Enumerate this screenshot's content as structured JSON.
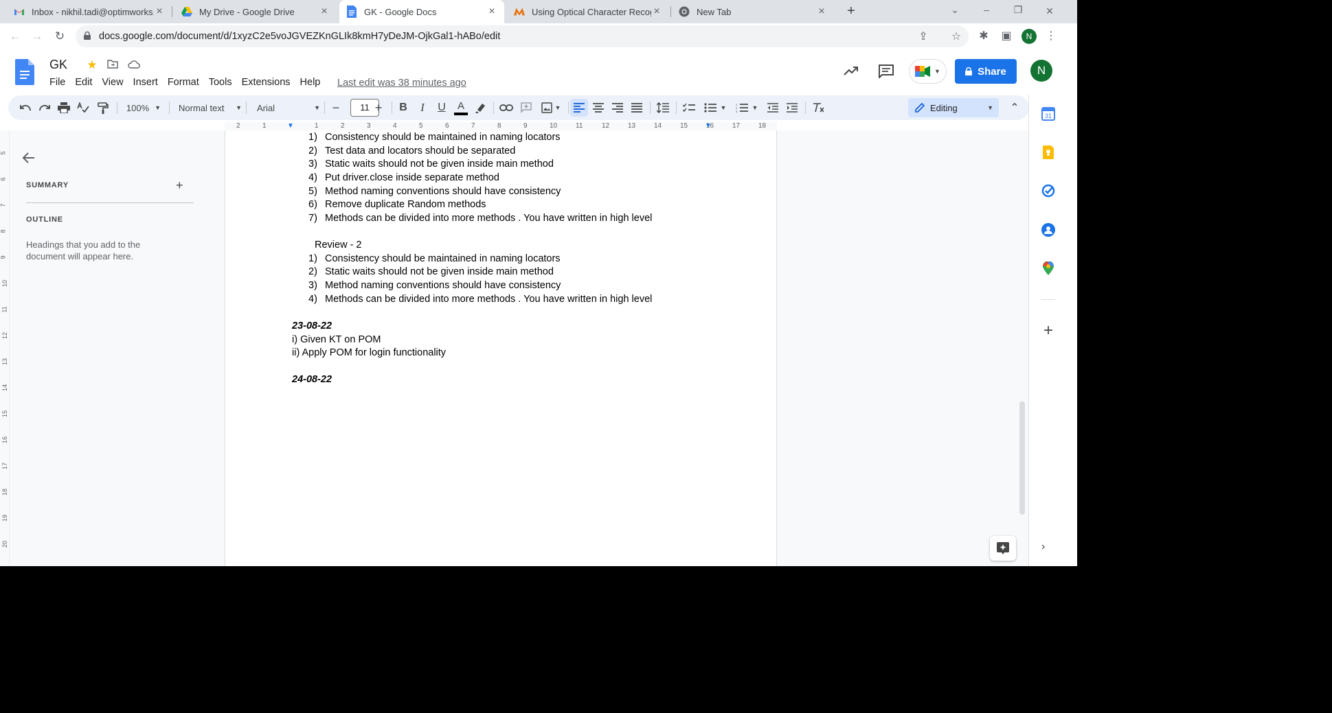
{
  "browser": {
    "tabs": [
      {
        "title": "Inbox - nikhil.tadi@optimworks.c",
        "icon": "gmail-icon"
      },
      {
        "title": "My Drive - Google Drive",
        "icon": "drive-icon"
      },
      {
        "title": "GK - Google Docs",
        "icon": "docs-icon",
        "active": true
      },
      {
        "title": "Using Optical Character Recognit",
        "icon": "ocr-site-icon"
      },
      {
        "title": "New Tab",
        "icon": "chrome-icon"
      }
    ],
    "url": "docs.google.com/document/d/1xyzC2e5voJGVEZKnGLIk8kmH7yDeJM-OjkGal1-hABo/edit",
    "profile_initial": "N"
  },
  "docs": {
    "title": "GK",
    "menu": [
      "File",
      "Edit",
      "View",
      "Insert",
      "Format",
      "Tools",
      "Extensions",
      "Help"
    ],
    "last_edit": "Last edit was 38 minutes ago",
    "share_label": "Share",
    "account_initial": "N"
  },
  "toolbar": {
    "zoom": "100%",
    "style": "Normal text",
    "font": "Arial",
    "font_size": "11",
    "mode": "Editing"
  },
  "outline": {
    "summary_label": "SUMMARY",
    "outline_label": "OUTLINE",
    "hint": "Headings that you add to the document will appear here."
  },
  "ruler": {
    "horizontal": [
      "2",
      "1",
      "1",
      "2",
      "3",
      "4",
      "5",
      "6",
      "7",
      "8",
      "9",
      "10",
      "11",
      "12",
      "13",
      "14",
      "15",
      "16",
      "17",
      "18"
    ],
    "vertical": [
      "5",
      "6",
      "7",
      "8",
      "9",
      "10",
      "11",
      "12",
      "13",
      "14",
      "15",
      "16",
      "17",
      "18",
      "19",
      "20"
    ]
  },
  "document": {
    "list1": [
      {
        "n": "1)",
        "text": "Consistency should be maintained in naming locators"
      },
      {
        "n": "2)",
        "text": "Test data and locators should be separated"
      },
      {
        "n": "3)",
        "text": "Static waits should not be given inside main method"
      },
      {
        "n": "4)",
        "text": "Put driver.close inside separate method"
      },
      {
        "n": "5)",
        "text": "Method naming conventions should have consistency"
      },
      {
        "n": "6)",
        "text": "Remove duplicate Random methods"
      },
      {
        "n": "7)",
        "text": "Methods can be divided into more methods . You have written in high level"
      }
    ],
    "review_heading": "Review - 2",
    "list2": [
      {
        "n": "1)",
        "text": "Consistency should be maintained in naming locators"
      },
      {
        "n": "2)",
        "text": "Static waits should not be given inside main method"
      },
      {
        "n": "3)",
        "text": "Method naming conventions should have consistency"
      },
      {
        "n": "4)",
        "text": "Methods can be divided into more methods . You have written in high level"
      }
    ],
    "date1": "23-08-22",
    "date1_items": [
      "i) Given KT on POM",
      "ii) Apply POM for login functionality"
    ],
    "date2": "24-08-22"
  },
  "colors": {
    "accent": "#1a73e8",
    "avatar": "#137333",
    "toolbar_bg": "#edf2fa"
  }
}
